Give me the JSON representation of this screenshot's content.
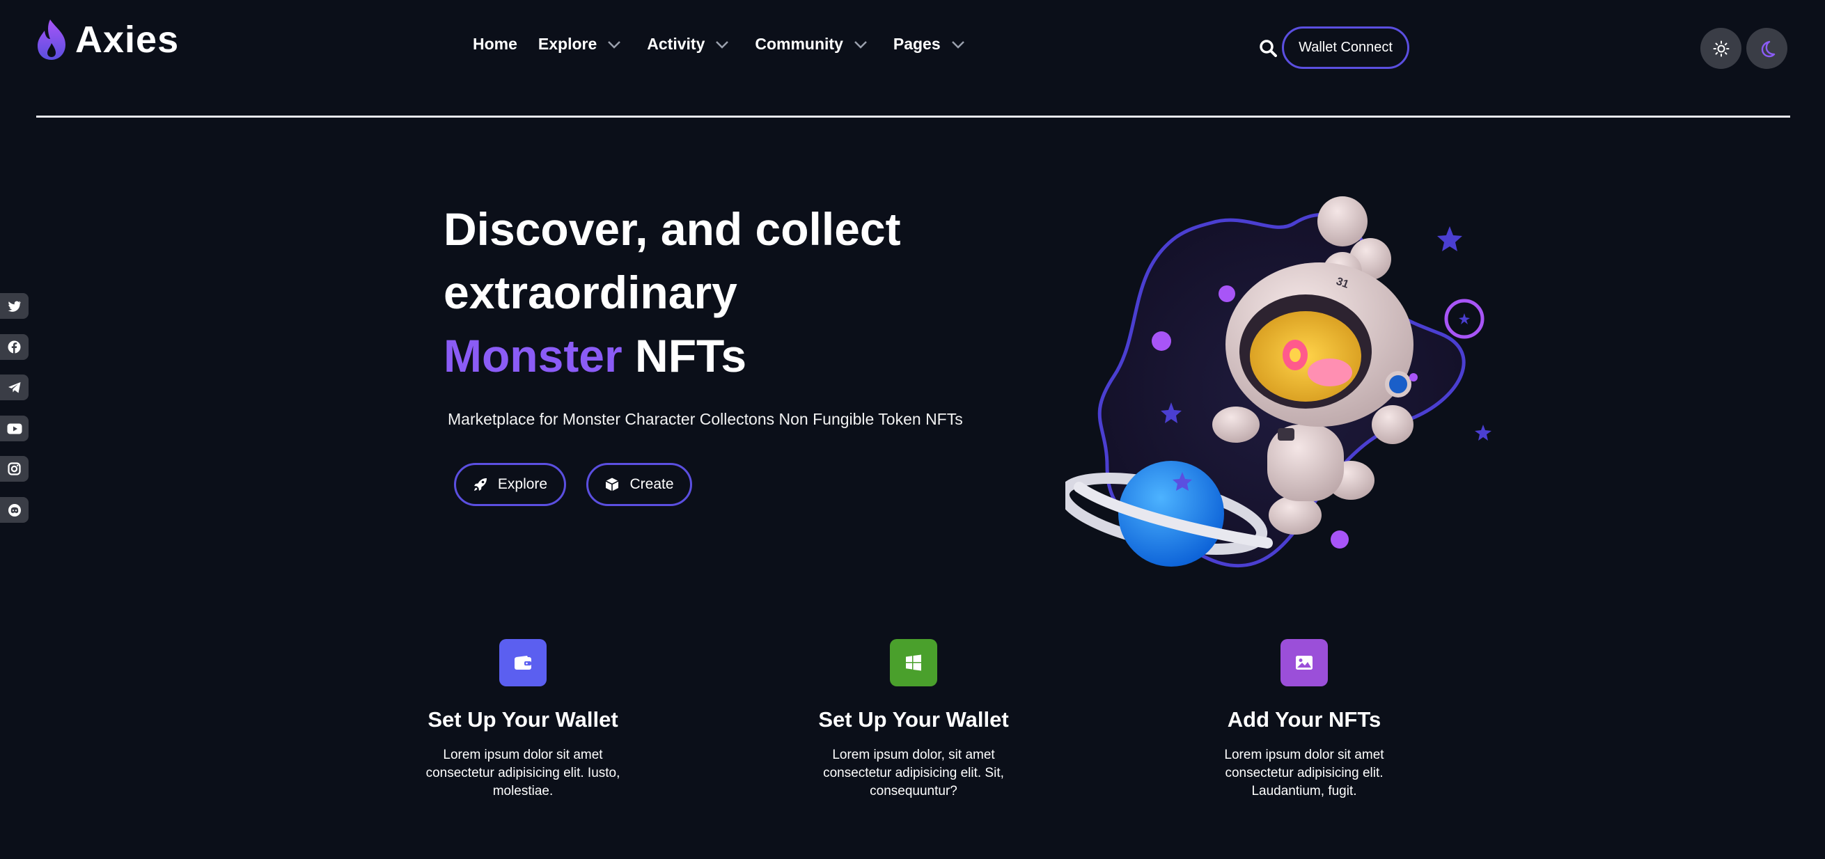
{
  "brand": {
    "name": "Axies"
  },
  "nav": {
    "items": [
      {
        "label": "Home"
      },
      {
        "label": "Explore"
      },
      {
        "label": "Activity"
      },
      {
        "label": "Community"
      },
      {
        "label": "Pages"
      }
    ]
  },
  "header": {
    "wallet_label": "Wallet Connect"
  },
  "socials": [
    "twitter-icon",
    "facebook-icon",
    "telegram-icon",
    "youtube-icon",
    "instagram-icon",
    "discord-icon"
  ],
  "hero": {
    "line1": "Discover, and collect",
    "line2": "extraordinary",
    "accent": "Monster",
    "suffix": " NFTs",
    "subtitle": "Marketplace for Monster Character Collectons Non Fungible Token NFTs",
    "explore_label": "Explore",
    "create_label": "Create"
  },
  "features": [
    {
      "title": "Set Up Your Wallet",
      "desc": "Lorem ipsum dolor sit amet consectetur adipisicing elit. Iusto, molestiae.",
      "color": "#5b5ff0",
      "icon": "wallet-icon"
    },
    {
      "title": "Set Up Your Wallet",
      "desc": "Lorem ipsum dolor, sit amet consectetur adipisicing elit. Sit, consequuntur?",
      "color": "#4aa02c",
      "icon": "windows-icon"
    },
    {
      "title": "Add Your NFTs",
      "desc": "Lorem ipsum dolor sit amet consectetur adipisicing elit. Laudantium, fugit.",
      "color": "#9b4fd9",
      "icon": "image-icon"
    }
  ],
  "colors": {
    "background": "#0b0f19",
    "accent": "#8b5cf6",
    "border": "#5b4fe0"
  }
}
